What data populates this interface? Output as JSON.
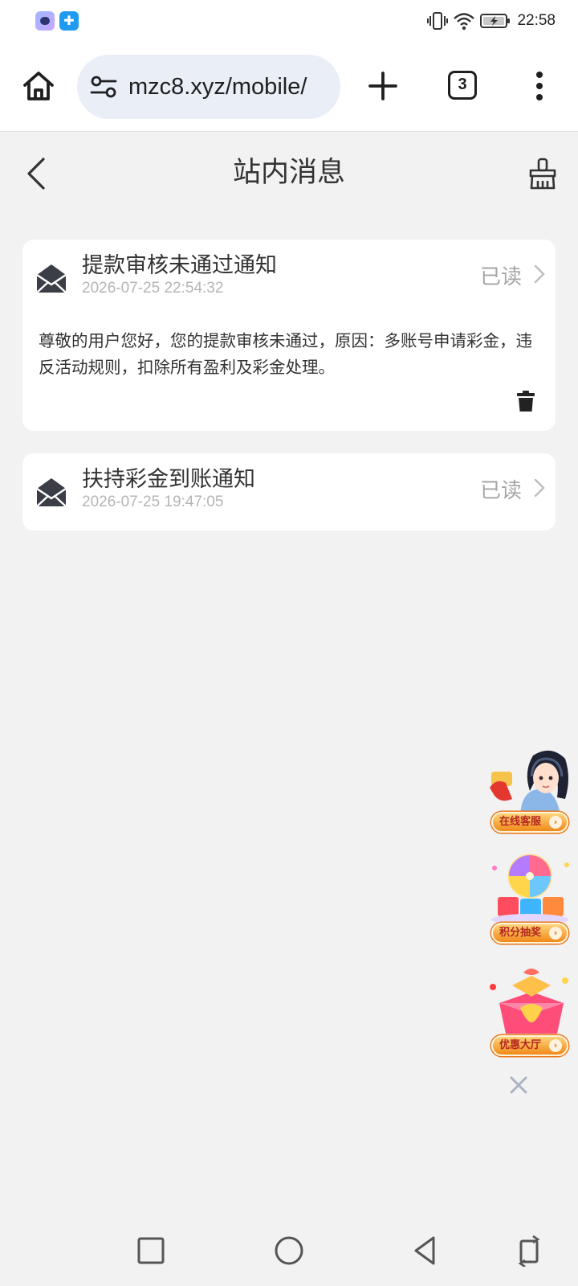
{
  "status_bar": {
    "time": "22:58",
    "icons": [
      "vibrate-icon",
      "wifi-icon",
      "battery-charging-icon"
    ],
    "apps": [
      "assistant-app-icon",
      "puzzle-app-icon"
    ]
  },
  "browser": {
    "url": "mzc8.xyz/mobile/",
    "tab_count": "3"
  },
  "page": {
    "title": "站内消息"
  },
  "messages": [
    {
      "title": "提款审核未通过通知",
      "time": "2026-07-25 22:54:32",
      "status": "已读",
      "body": "尊敬的用户您好，您的提款审核未通过，原因：多账号申请彩金，违反活动规则，扣除所有盈利及彩金处理。"
    },
    {
      "title": "扶持彩金到账通知",
      "time": "2026-07-25 19:47:05",
      "status": "已读"
    }
  ],
  "widgets": [
    {
      "label": "在线客服"
    },
    {
      "label": "积分抽奖"
    },
    {
      "label": "优惠大厅"
    }
  ],
  "colors": {
    "background": "#f2f2f2",
    "card": "#ffffff",
    "muted_text": "#a6a6a6",
    "widget_accent": "#f08a1a"
  }
}
